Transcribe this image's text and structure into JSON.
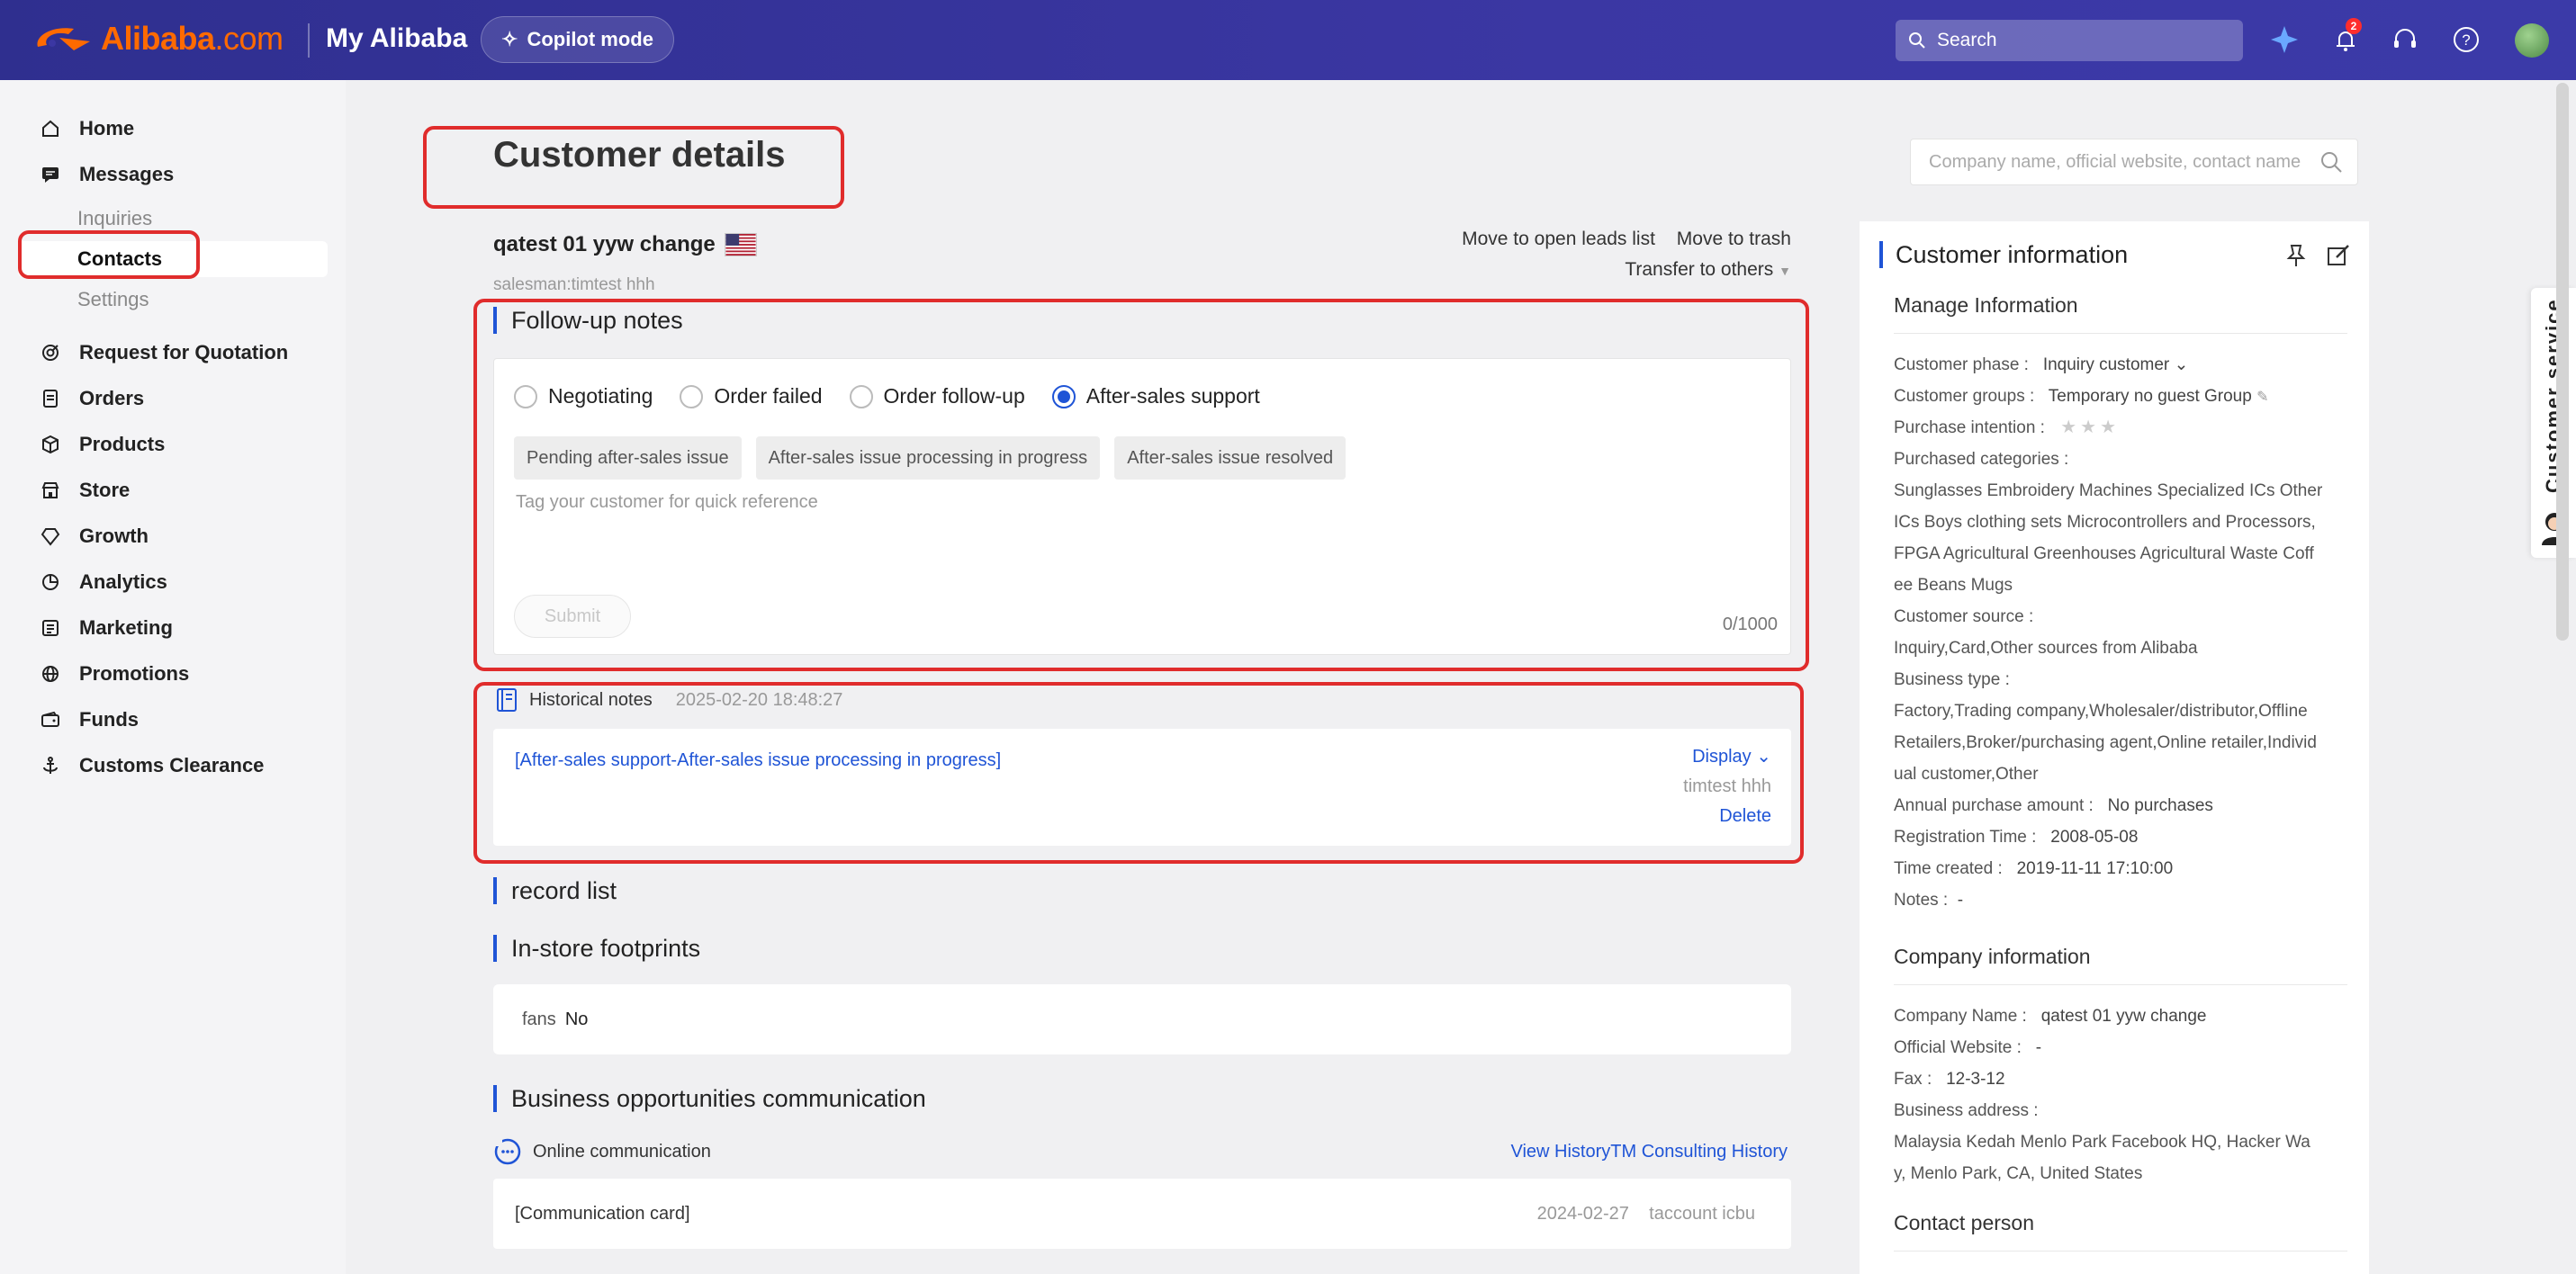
{
  "topbar": {
    "logo_main": "Alibaba",
    "logo_suffix": ".com",
    "my_alibaba": "My Alibaba",
    "copilot": "Copilot mode",
    "search_placeholder": "Search",
    "notification_count": "2",
    "icons": [
      "sparkle-icon",
      "bell-icon",
      "headset-icon",
      "help-icon",
      "avatar"
    ]
  },
  "sidebar": {
    "items": [
      {
        "label": "Home",
        "icon": "home-icon"
      },
      {
        "label": "Messages",
        "icon": "message-icon"
      },
      {
        "label": "Request for Quotation",
        "icon": "rfq-icon"
      },
      {
        "label": "Orders",
        "icon": "orders-icon"
      },
      {
        "label": "Products",
        "icon": "products-icon"
      },
      {
        "label": "Store",
        "icon": "store-icon"
      },
      {
        "label": "Growth",
        "icon": "growth-icon"
      },
      {
        "label": "Analytics",
        "icon": "analytics-icon"
      },
      {
        "label": "Marketing",
        "icon": "marketing-icon"
      },
      {
        "label": "Promotions",
        "icon": "promotions-icon"
      },
      {
        "label": "Funds",
        "icon": "funds-icon"
      },
      {
        "label": "Customs Clearance",
        "icon": "customs-icon"
      }
    ],
    "messages_sub": [
      "Inquiries",
      "Contacts",
      "Settings"
    ]
  },
  "page": {
    "title": "Customer details",
    "search_placeholder": "Company name, official website, contact name",
    "customer_name": "qatest 01 yyw change",
    "salesman": "salesman:timtest hhh",
    "actions": {
      "move_open": "Move to open leads list",
      "move_trash": "Move to trash",
      "transfer": "Transfer to others"
    }
  },
  "followup": {
    "title": "Follow-up notes",
    "options": [
      "Negotiating",
      "Order failed",
      "Order follow-up",
      "After-sales support"
    ],
    "selected_index": 3,
    "tags": [
      "Pending after-sales issue",
      "After-sales issue processing in progress",
      "After-sales issue resolved"
    ],
    "placeholder": "Tag your customer for quick reference",
    "submit": "Submit",
    "counter": "0/1000"
  },
  "history": {
    "label": "Historical notes",
    "time": "2025-02-20 18:48:27",
    "note": "[After-sales support-After-sales issue processing in progress]",
    "display": "Display",
    "author": "timtest hhh",
    "delete": "Delete"
  },
  "record_list": {
    "title": "record list"
  },
  "footprints": {
    "title": "In-store footprints",
    "fans_label": "fans",
    "fans_value": "No"
  },
  "business": {
    "title": "Business opportunities communication",
    "online": "Online communication",
    "view_history": "View HistoryTM Consulting History",
    "card": "[Communication card]",
    "card_date": "2024-02-27",
    "card_user": "taccount icbu"
  },
  "customer_info": {
    "title": "Customer information",
    "manage": {
      "heading": "Manage Information",
      "phase_label": "Customer phase :",
      "phase_value": "Inquiry customer",
      "groups_label": "Customer groups :",
      "groups_value": "Temporary no guest Group",
      "intention_label": "Purchase intention :",
      "intention_stars": 0,
      "categories_label": "Purchased categories :",
      "categories_lines": [
        "Sunglasses Embroidery Machines Specialized ICs Other",
        "ICs Boys clothing sets Microcontrollers and Processors,",
        "FPGA Agricultural Greenhouses Agricultural Waste Coff",
        "ee Beans Mugs"
      ],
      "source_label": "Customer source :",
      "source_value": "Inquiry,Card,Other sources from Alibaba",
      "btype_label": "Business type :",
      "btype_lines": [
        "Factory,Trading company,Wholesaler/distributor,Offline",
        "Retailers,Broker/purchasing agent,Online retailer,Individ",
        "ual customer,Other"
      ],
      "annual_label": "Annual purchase amount :",
      "annual_value": "No purchases",
      "reg_label": "Registration Time :",
      "reg_value": "2008-05-08",
      "created_label": "Time created :",
      "created_value": "2019-11-11 17:10:00",
      "notes_label": "Notes :",
      "notes_value": "-"
    },
    "company": {
      "heading": "Company information",
      "name_label": "Company Name :",
      "name_value": "qatest 01 yyw change",
      "website_label": "Official Website :",
      "website_value": "-",
      "fax_label": "Fax :",
      "fax_value": "12-3-12",
      "address_label": "Business address :",
      "address_lines": [
        "Malaysia  Kedah  Menlo Park  Facebook HQ, Hacker Wa",
        "y, Menlo Park, CA, United States"
      ]
    },
    "contact_heading": "Contact person"
  },
  "customer_service": "Customer service",
  "colors": {
    "brand": "#ff6a00",
    "accent": "#1f54d6",
    "highlight": "#e02c2c"
  }
}
